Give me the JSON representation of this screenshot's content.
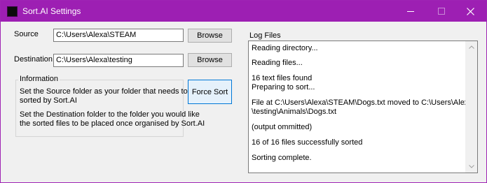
{
  "window": {
    "title": "Sort.AI Settings",
    "accent_color": "#9d1fb3",
    "icons": [
      "app-icon",
      "minimize-icon",
      "maximize-icon",
      "close-icon"
    ]
  },
  "source": {
    "label": "Source",
    "value": "C:\\Users\\Alexa\\STEAM",
    "browse_label": "Browse"
  },
  "destination": {
    "label": "Destination",
    "value": "C:\\Users\\Alexa\\testing",
    "browse_label": "Browse"
  },
  "information": {
    "title": "Information",
    "line1": "Set the Source folder as your folder that needs to be",
    "line2": "sorted by Sort.AI",
    "line3": "Set the Destination folder to the folder you would like",
    "line4": "the sorted files to be placed once organised by Sort.AI"
  },
  "force_sort_label": "Force Sort",
  "log": {
    "title": "Log Files",
    "lines": [
      "Reading directory...",
      "Reading files...",
      "16 text files found",
      "Preparing to sort...",
      "File at C:\\Users\\Alexa\\STEAM\\Dogs.txt moved to C:\\Users\\Alexa",
      "\\testing\\Animals\\Dogs.txt",
      "(output ommitted)",
      "16 of 16 files successfully sorted",
      "Sorting complete."
    ]
  }
}
